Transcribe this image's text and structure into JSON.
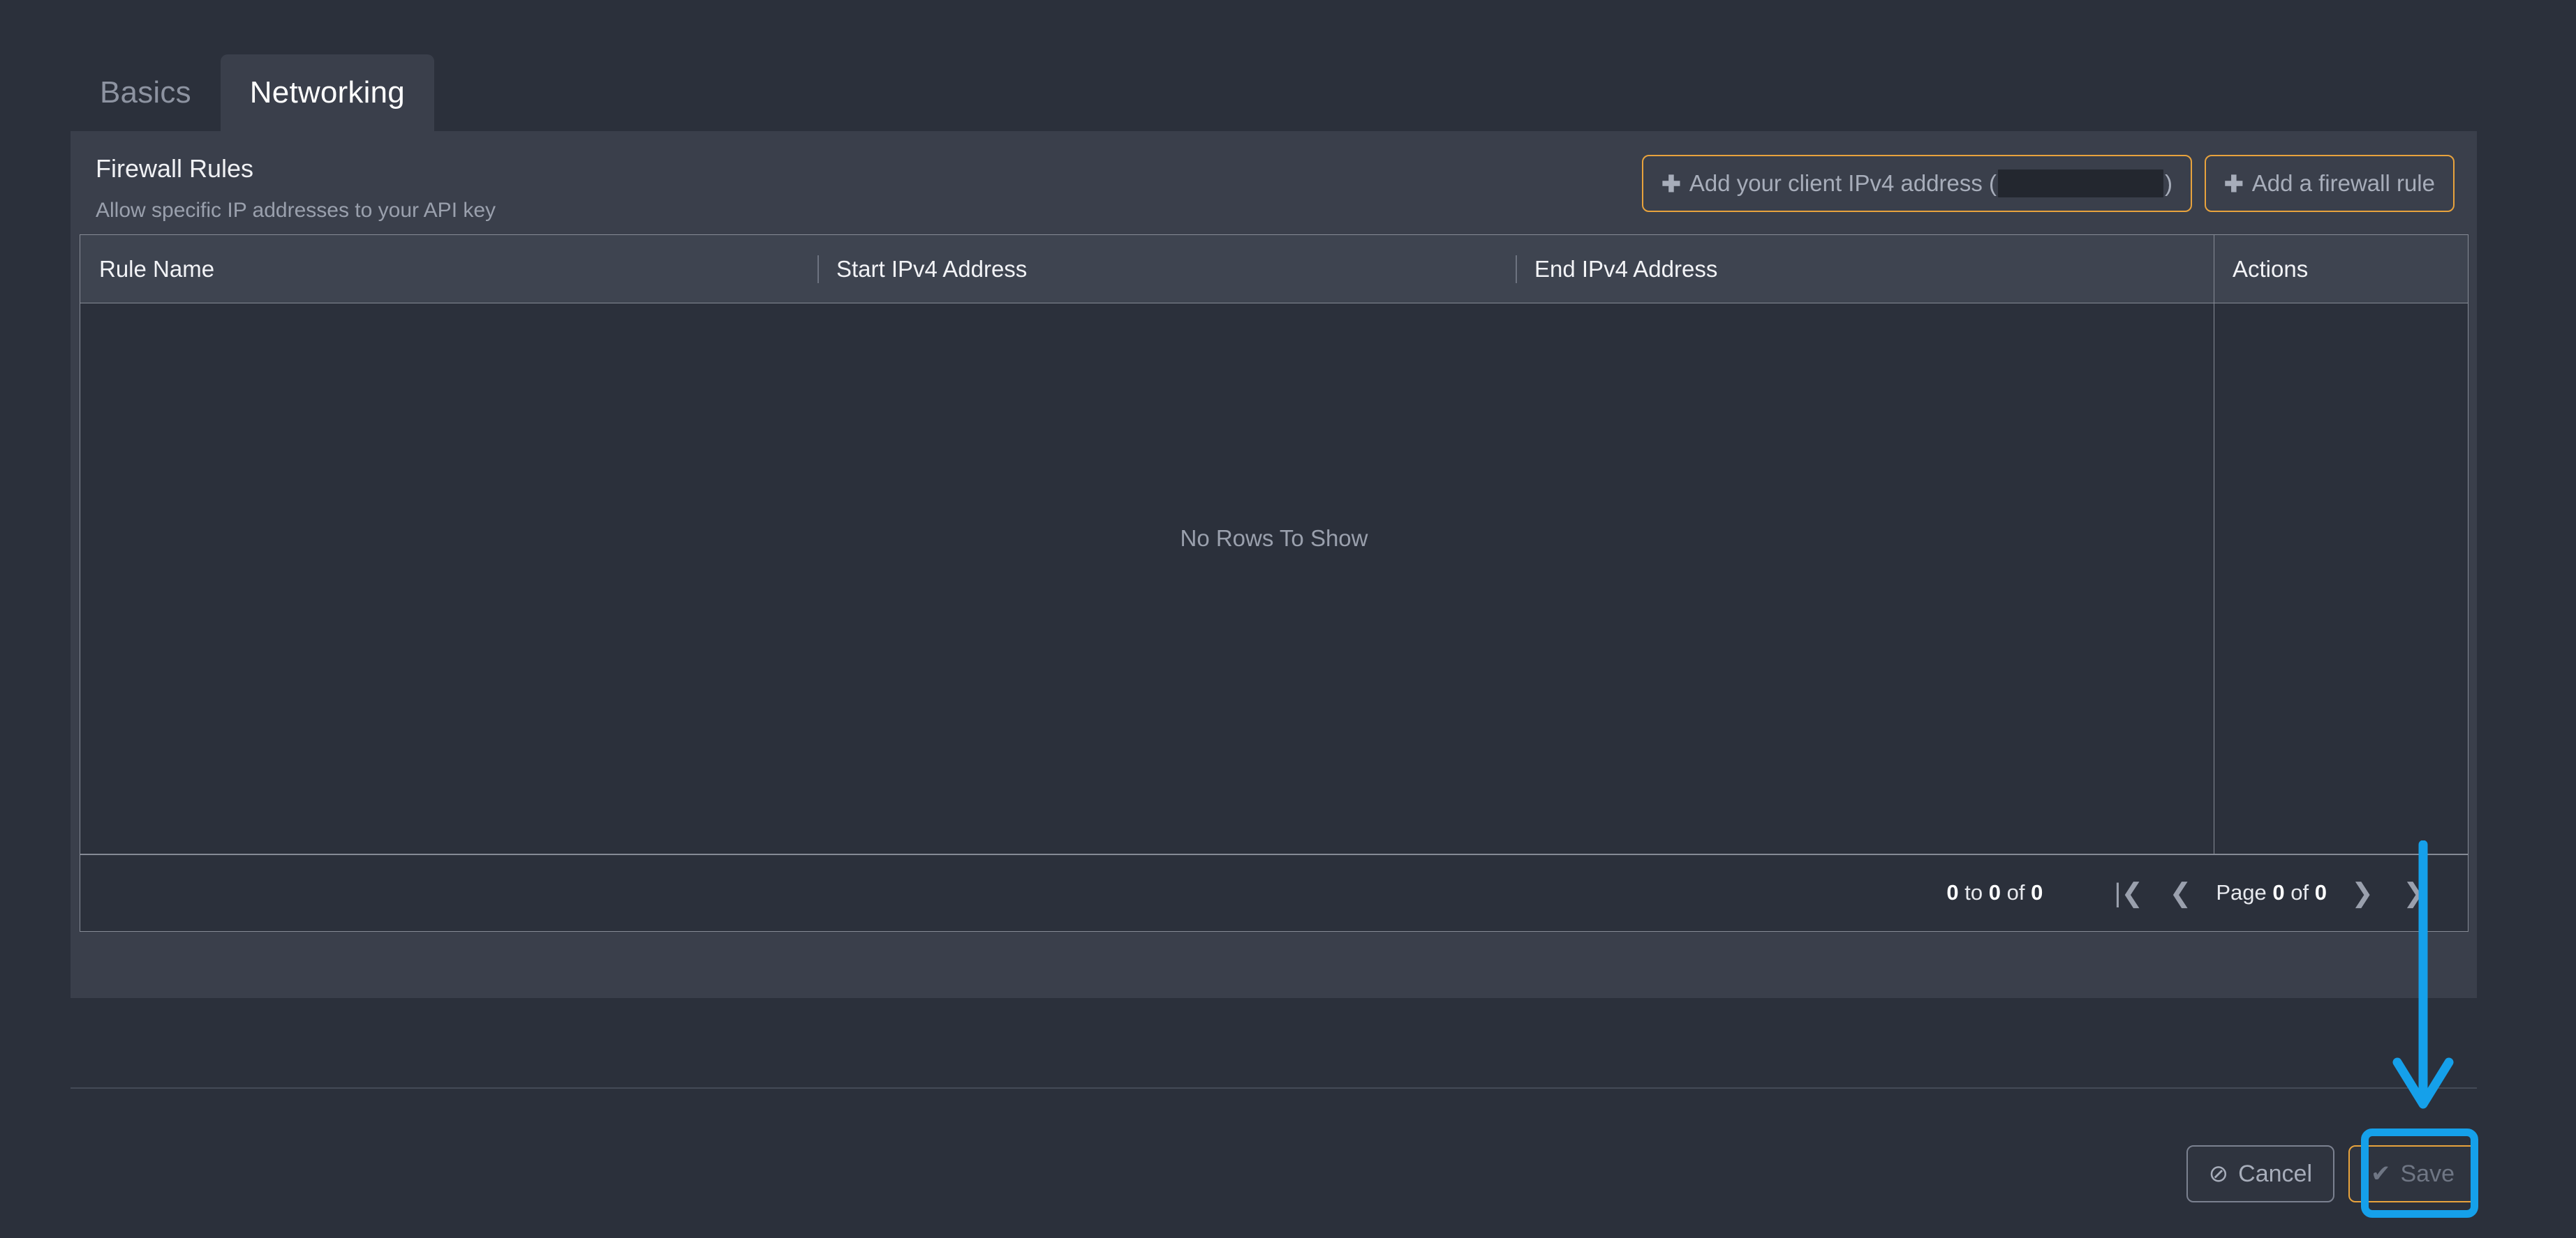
{
  "tabs": [
    {
      "label": "Basics",
      "active": false
    },
    {
      "label": "Networking",
      "active": true
    }
  ],
  "panel": {
    "title": "Firewall Rules",
    "subtitle": "Allow specific IP addresses to your API key",
    "actions": {
      "add_client_ip": {
        "plus": "✚",
        "label": "Add your client IPv4 address (",
        "value_redacted": "",
        "close_paren": ")"
      },
      "add_firewall_rule": {
        "plus": "✚",
        "label": "Add a firewall rule"
      }
    }
  },
  "grid": {
    "columns": [
      "Rule Name",
      "Start IPv4 Address",
      "End IPv4 Address",
      "Actions"
    ],
    "empty_message": "No Rows To Show",
    "rows": [],
    "pagination": {
      "range_prefix": "0",
      "range_to": "to",
      "range_end": "0",
      "range_of": "of",
      "range_total": "0",
      "first_icon": "|❮",
      "prev_icon": "❮",
      "page_word": "Page",
      "page_current": "0",
      "page_of": "of",
      "page_total": "0",
      "next_icon": "❯",
      "last_icon": "❯"
    }
  },
  "footer": {
    "cancel_label": "Cancel",
    "cancel_icon": "⊘",
    "save_label": "Save",
    "save_icon": "✔"
  },
  "colors": {
    "page_background": "#2b303b",
    "panel_background": "#3a3f4b",
    "grid_header_background": "#3e4450",
    "accent_orange": "#e8a33d",
    "annotation_blue": "#15a0ea",
    "muted_text": "#9aa0ad",
    "primary_text": "#f0f1f4"
  }
}
